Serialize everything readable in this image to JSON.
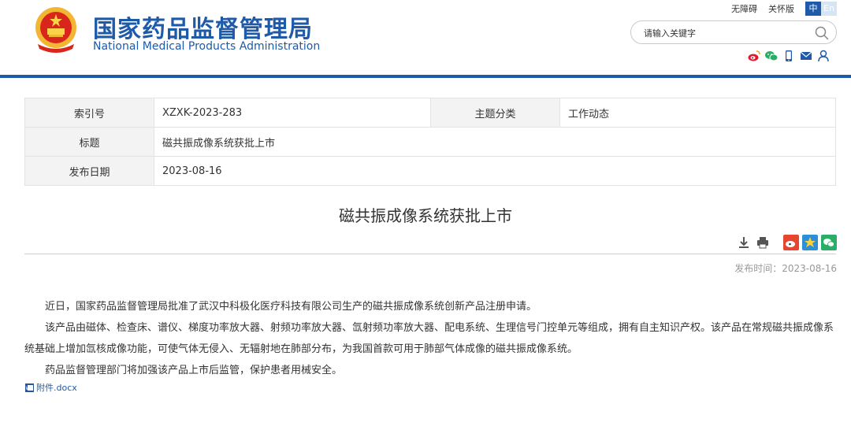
{
  "header": {
    "title_cn": "国家药品监督管理局",
    "title_en": "National Medical Products Administration",
    "accessibility_link": "无障碍",
    "care_version_link": "关怀版",
    "lang_zh": "中",
    "lang_en": "En",
    "search_placeholder": "请输入关键字",
    "social_icons": [
      "weibo-icon",
      "wechat-icon",
      "mobile-icon",
      "mail-icon",
      "user-icon"
    ],
    "brand_color": "#1e5aa8"
  },
  "info": {
    "index_label": "索引号",
    "index_value": "XZXK-2023-283",
    "category_label": "主题分类",
    "category_value": "工作动态",
    "title_label": "标题",
    "title_value": "磁共振成像系统获批上市",
    "date_label": "发布日期",
    "date_value": "2023-08-16"
  },
  "article": {
    "title": "磁共振成像系统获批上市",
    "publish_time": "发布时间：2023-08-16",
    "paragraphs": [
      "近日，国家药品监督管理局批准了武汉中科极化医疗科技有限公司生产的磁共振成像系统创新产品注册申请。",
      "该产品由磁体、检查床、谱仪、梯度功率放大器、射频功率放大器、氙射频功率放大器、配电系统、生理信号门控单元等组成，拥有自主知识产权。该产品在常规磁共振成像系统基础上增加氙核成像功能，可使气体无侵入、无辐射地在肺部分布，为我国首款可用于肺部气体成像的磁共振成像系统。",
      "药品监督管理部门将加强该产品上市后监管，保护患者用械安全。"
    ],
    "attachment": "附件.docx"
  }
}
